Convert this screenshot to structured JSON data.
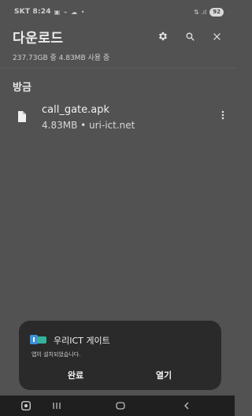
{
  "status_bar": {
    "carrier_time": "SKT 8:24",
    "notification_icons": "▣ ⌁ ☁ •",
    "signal_icons": "⇅ .ıl",
    "battery": "92"
  },
  "app_bar": {
    "title": "다운로드",
    "actions": [
      "gear-icon",
      "search-icon",
      "close-icon"
    ]
  },
  "storage_info": "237.73GB 중 4.83MB 사용 중",
  "sections": [
    {
      "header": "방금",
      "items": [
        {
          "file_name": "call_gate.apk",
          "meta": "4.83MB • uri-ict.net",
          "icon": "file-icon"
        }
      ]
    }
  ],
  "dialog": {
    "app_name": "우리ICT 게이트",
    "message": "앱이 설치되었습니다.",
    "done_label": "완료",
    "open_label": "열기"
  },
  "nav_bar": {
    "items": [
      "accessibility-icon",
      "recent-apps-icon",
      "home-icon",
      "back-icon"
    ]
  },
  "colors": {
    "background": "#525252",
    "dialog": "#2a2a2a",
    "nav_bar": "#1f1f1f",
    "app_icon_blue": "#3d8fd6",
    "app_icon_green": "#34b39a"
  }
}
